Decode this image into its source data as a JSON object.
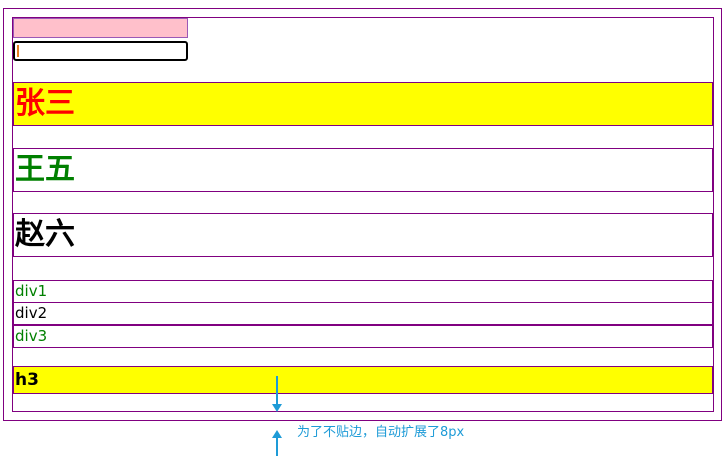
{
  "rows": {
    "zhang": "张三",
    "wang": "王五",
    "zhao": "赵六"
  },
  "divs": [
    "div1",
    "div2",
    "div3"
  ],
  "h3": "h3",
  "annotation": "为了不贴边，自动扩展了8px",
  "colors": {
    "border": "#800080",
    "highlight": "#ffff00",
    "zhang_text": "#ff0000",
    "wang_text": "#008000",
    "annotation": "#1e9bd7"
  },
  "icons": [
    "arrow-down-icon",
    "arrow-up-icon"
  ]
}
